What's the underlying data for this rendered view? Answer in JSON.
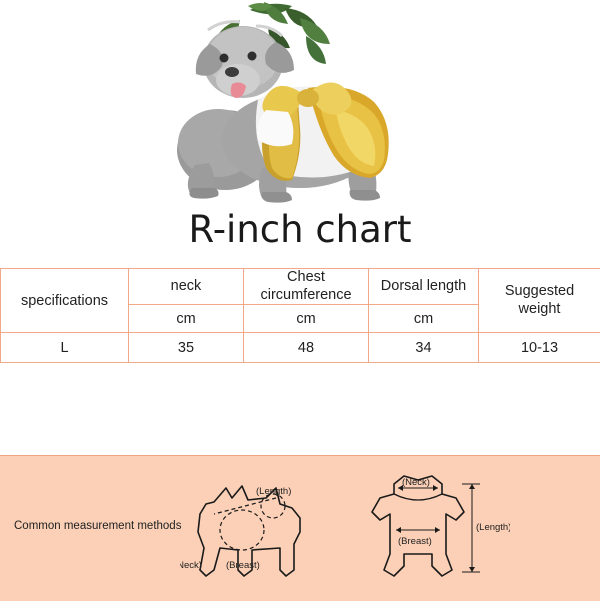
{
  "title": "R-inch chart",
  "photo": {
    "alt_name": "dog-wearing-gold-costume-photo"
  },
  "table": {
    "headers": {
      "specifications": "specifications",
      "neck": "neck",
      "chest": "Chest circumference",
      "chest_line1": "Chest",
      "chest_line2": "circumference",
      "dorsal": "Dorsal length",
      "weight_line1": "Suggested",
      "weight_line2": "weight"
    },
    "units": {
      "neck": "cm",
      "chest": "cm",
      "dorsal": "cm"
    },
    "rows": [
      {
        "size": "L",
        "neck": "35",
        "chest": "48",
        "dorsal": "34",
        "weight": "10-13"
      }
    ]
  },
  "measurement": {
    "label": "Common measurement methods",
    "side_view": {
      "length": "(Length)",
      "breast": "(Breast)",
      "neck": "(Neck)"
    },
    "front_view": {
      "neck": "(Neck)",
      "length": "(Length)",
      "breast": "(Breast)"
    }
  },
  "colors": {
    "panel_bg": "#fbd0b6",
    "table_border": "#f2a98a",
    "text": "#222222"
  }
}
